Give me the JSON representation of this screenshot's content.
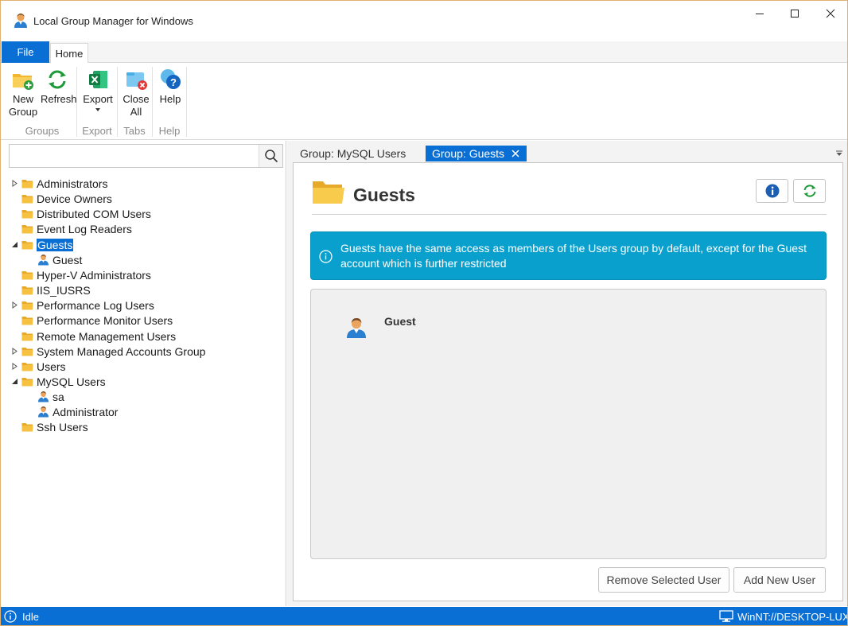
{
  "window": {
    "title": "Local Group Manager for Windows"
  },
  "ribbon": {
    "file_tab": "File",
    "home_tab": "Home",
    "buttons": {
      "new_group": [
        "New",
        "Group"
      ],
      "refresh": "Refresh",
      "export": "Export",
      "close_all": [
        "Close",
        "All"
      ],
      "help": "Help"
    },
    "groups": {
      "groups": "Groups",
      "export": "Export",
      "tabs": "Tabs",
      "help": "Help"
    }
  },
  "search": {
    "value": "",
    "placeholder": ""
  },
  "tree": [
    {
      "type": "group",
      "label": "Administrators",
      "expander": "collapsed"
    },
    {
      "type": "group",
      "label": "Device Owners",
      "expander": "none"
    },
    {
      "type": "group",
      "label": "Distributed COM Users",
      "expander": "none"
    },
    {
      "type": "group",
      "label": "Event Log Readers",
      "expander": "none"
    },
    {
      "type": "group",
      "label": "Guests",
      "expander": "expanded",
      "selected": true
    },
    {
      "type": "user",
      "label": "Guest"
    },
    {
      "type": "group",
      "label": "Hyper-V Administrators",
      "expander": "none"
    },
    {
      "type": "group",
      "label": "IIS_IUSRS",
      "expander": "none"
    },
    {
      "type": "group",
      "label": "Performance Log Users",
      "expander": "collapsed"
    },
    {
      "type": "group",
      "label": "Performance Monitor Users",
      "expander": "none"
    },
    {
      "type": "group",
      "label": "Remote Management Users",
      "expander": "none"
    },
    {
      "type": "group",
      "label": "System Managed Accounts Group",
      "expander": "collapsed"
    },
    {
      "type": "group",
      "label": "Users",
      "expander": "collapsed"
    },
    {
      "type": "group",
      "label": "MySQL Users",
      "expander": "expanded"
    },
    {
      "type": "user",
      "label": "sa"
    },
    {
      "type": "user",
      "label": "Administrator"
    },
    {
      "type": "group",
      "label": "Ssh Users",
      "expander": "none"
    }
  ],
  "doc_tabs": {
    "inactive": "Group: MySQL Users",
    "active": "Group: Guests"
  },
  "group_view": {
    "title": "Guests",
    "description": "Guests have the same access as members of the Users group by default, except for the Guest account which is further restricted",
    "members": [
      "Guest"
    ],
    "remove_button": "Remove Selected User",
    "add_button": "Add New User"
  },
  "status": {
    "text": "Idle",
    "host": "WinNT://DESKTOP-LUX"
  },
  "colors": {
    "accent": "#0a6fd4",
    "alert": "#0aa0cd",
    "folder": "#f6c141"
  }
}
